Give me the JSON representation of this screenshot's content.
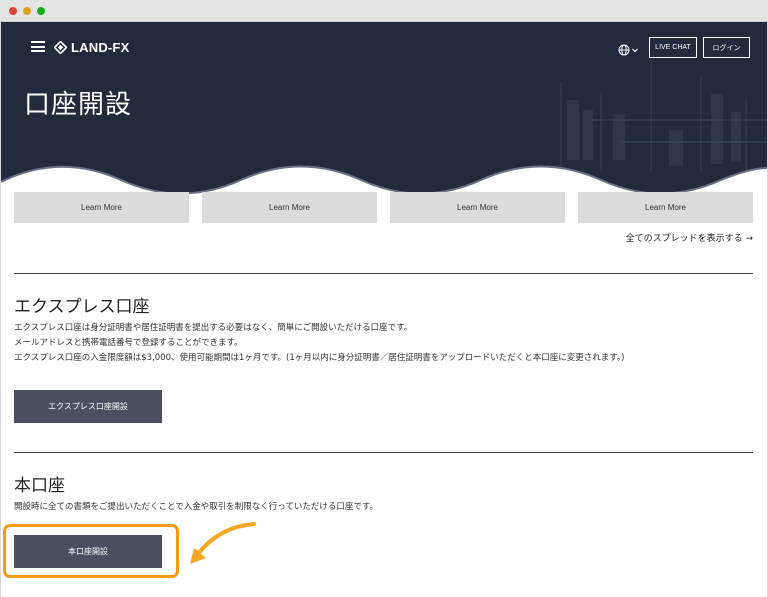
{
  "header": {
    "logo_text": "LAND-FX",
    "live_chat_label": "LIVE CHAT",
    "login_label": "ログイン"
  },
  "hero": {
    "title": "口座開設"
  },
  "learn_more": [
    "Learn More",
    "Learn More",
    "Learn More",
    "Learn More"
  ],
  "spread_link": "全てのスプレッドを表示する →",
  "express": {
    "title": "エクスプレス口座",
    "lines": [
      "エクスプレス口座は身分証明書や居住証明書を提出する必要はなく、簡単にご開設いただける口座です。",
      "メールアドレスと携帯電話番号で登録することができます。",
      "エクスプレス口座の入金限度額は$3,000、使用可能期間は1ヶ月です。(1ヶ月以内に身分証明書／居住証明書をアップロードいただくと本口座に変更されます。)"
    ],
    "button_label": "エクスプレス口座開設"
  },
  "real": {
    "title": "本口座",
    "line": "開設時に全ての書類をご提出いただくことで入金や取引を制限なく行っていただける口座です。",
    "button_label": "本口座開設"
  },
  "colors": {
    "hero_bg": "#232a3c",
    "button_dark": "#4a505f",
    "highlight": "#f39c12"
  },
  "icons": [
    "menu-icon",
    "logo-diamond-icon",
    "globe-icon",
    "chevron-down-icon",
    "arrow-right-icon"
  ]
}
